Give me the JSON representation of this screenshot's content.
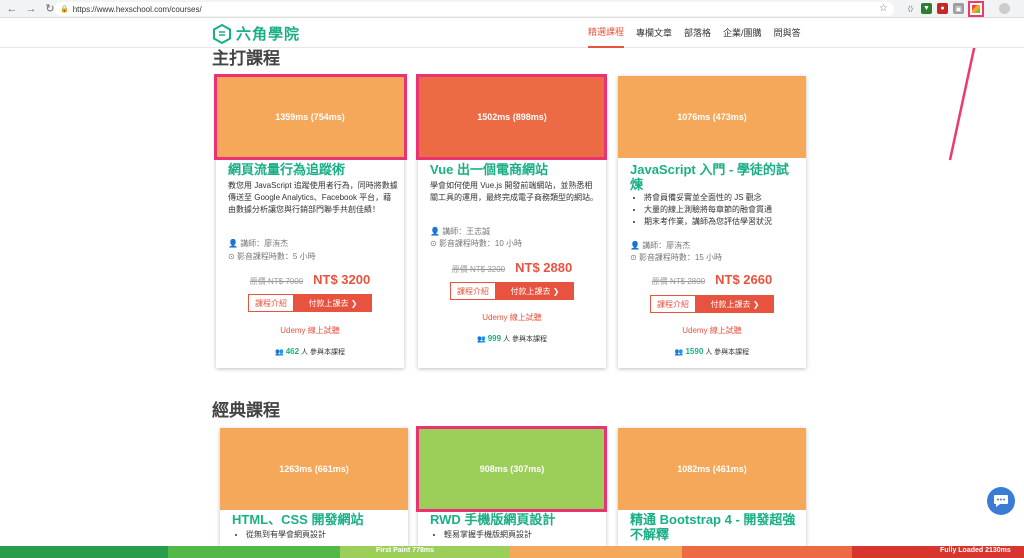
{
  "browser": {
    "url": "https://www.hexschool.com/courses/",
    "back_icon": "←",
    "forward_icon": "→",
    "reload_icon": "↻"
  },
  "site": {
    "logo_text": "六角學院",
    "nav": [
      "精選課程",
      "專欄文章",
      "部落格",
      "企業/團購",
      "問與答"
    ]
  },
  "sections": {
    "featured": "主打課程",
    "classic": "經典課程"
  },
  "featured_courses": [
    {
      "timing": "1359ms (754ms)",
      "title": "網頁流量行為追蹤術",
      "desc": "教您用 JavaScript 追蹤使用者行為，同時將數據傳送至 Google Analytics、Facebook 平台，藉由數據分析讓您與行銷部門聯手共創佳績！",
      "teacher": "講師：廖洧杰",
      "hours": "影音課程時數：5 小時",
      "orig_price": "原價 NT$ 7000",
      "price": "NT$ 3200",
      "btn_intro": "課程介紹",
      "btn_buy": "付款上課去 ❯",
      "udemy": "Udemy 線上試聽",
      "students": "462",
      "students_suffix": "人 參與本課程"
    },
    {
      "timing": "1502ms (898ms)",
      "title": "Vue 出一個電商網站",
      "desc": "學會如何使用 Vue.js 開發前端網站，並熟悉相關工具的運用，最終完成電子商務類型的網站。",
      "teacher": "講師：王志誠",
      "hours": "影音課程時數：10 小時",
      "orig_price": "原價 NT$ 3200",
      "price": "NT$ 2880",
      "btn_intro": "課程介紹",
      "btn_buy": "付款上課去 ❯",
      "udemy": "Udemy 線上試聽",
      "students": "999",
      "students_suffix": "人 參與本課程"
    },
    {
      "timing": "1076ms (473ms)",
      "title": "JavaScript 入門 - 學徒的試煉",
      "bullets": [
        "將會員備妥實並全面性的 JS 觀念",
        "大量的線上測驗將每章節的融會貫通",
        "期末考作業，講師為您評估學習狀況"
      ],
      "teacher": "講師：廖洧杰",
      "hours": "影音課程時數：15 小時",
      "orig_price": "原價 NT$ 2800",
      "price": "NT$ 2660",
      "btn_intro": "課程介紹",
      "btn_buy": "付款上課去 ❯",
      "udemy": "Udemy 線上試聽",
      "students": "1590",
      "students_suffix": "人 參與本課程"
    }
  ],
  "classic_courses": [
    {
      "timing": "1263ms (661ms)",
      "title": "HTML、CSS 開發網站",
      "bullets": [
        "從無到有學會網頁設計"
      ]
    },
    {
      "timing": "908ms (307ms)",
      "title": "RWD 手機版網頁設計",
      "bullets": [
        "輕易掌握手機版網頁設計"
      ]
    },
    {
      "timing": "1082ms (461ms)",
      "title": "精通 Bootstrap 4 - 開發超強不解釋",
      "bullets": []
    }
  ],
  "perf": {
    "first_paint": "First Paint 778ms",
    "fully_loaded": "Fully Loaded 2130ms"
  },
  "colors": {
    "accent": "#1aaf86",
    "price": "#e8533f",
    "highlight": "#ea3372"
  }
}
